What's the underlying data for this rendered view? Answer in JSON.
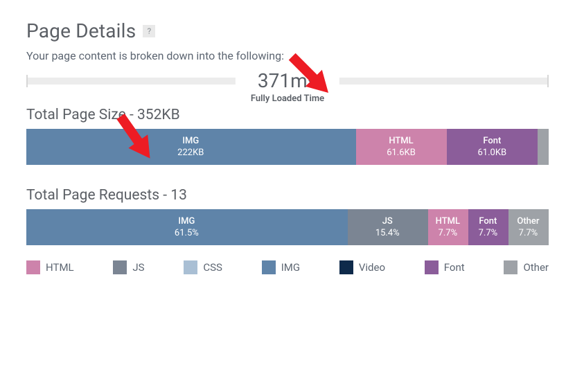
{
  "header": {
    "title": "Page Details",
    "help_icon_label": "?",
    "subtext": "Your page content is broken down into the following:"
  },
  "timing": {
    "value": "371ms",
    "label": "Fully Loaded Time"
  },
  "size_section": {
    "title": "Total Page Size - 352KB"
  },
  "requests_section": {
    "title": "Total Page Requests - 13"
  },
  "colors": {
    "HTML": "#cd83ab",
    "JS": "#7b8593",
    "CSS": "#a9bfd4",
    "IMG": "#5f84a9",
    "Video": "#0e2a4a",
    "Font": "#8b5d9a",
    "Other": "#9ea2a7"
  },
  "legend": [
    "HTML",
    "JS",
    "CSS",
    "IMG",
    "Video",
    "Font",
    "Other"
  ],
  "chart_data": [
    {
      "type": "bar",
      "title": "Total Page Size",
      "total": "352KB",
      "unit": "KB",
      "series": [
        {
          "name": "IMG",
          "value": 222,
          "display": "222KB"
        },
        {
          "name": "HTML",
          "value": 61.6,
          "display": "61.6KB"
        },
        {
          "name": "Font",
          "value": 61.0,
          "display": "61.0KB"
        },
        {
          "name": "Other",
          "value": 7.4,
          "display": ""
        }
      ]
    },
    {
      "type": "bar",
      "title": "Total Page Requests",
      "total": 13,
      "unit": "%",
      "series": [
        {
          "name": "IMG",
          "value": 61.5,
          "display": "61.5%"
        },
        {
          "name": "JS",
          "value": 15.4,
          "display": "15.4%"
        },
        {
          "name": "HTML",
          "value": 7.7,
          "display": "7.7%"
        },
        {
          "name": "Font",
          "value": 7.7,
          "display": "7.7%"
        },
        {
          "name": "Other",
          "value": 7.7,
          "display": "7.7%"
        }
      ]
    }
  ],
  "annotations": {
    "arrow1": "red-arrow",
    "arrow2": "red-arrow"
  }
}
